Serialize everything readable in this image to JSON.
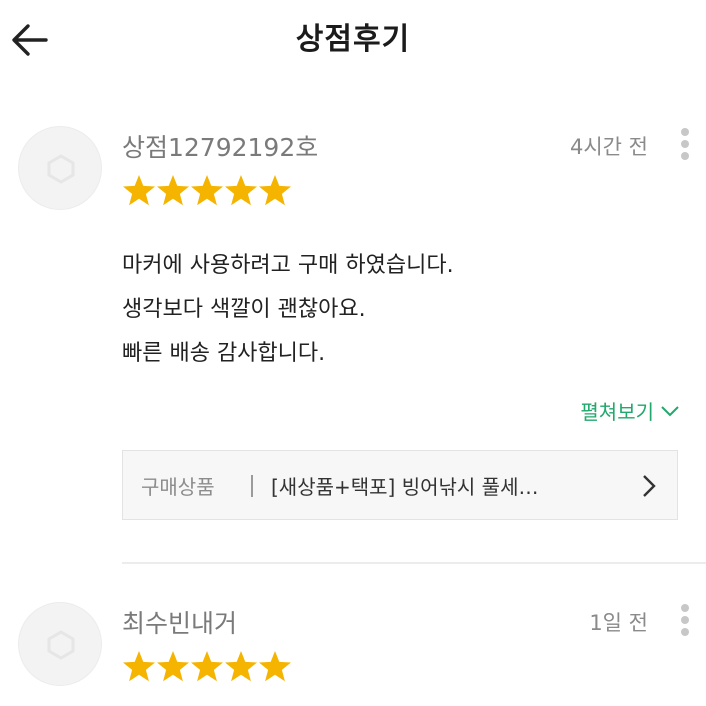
{
  "header": {
    "title": "상점후기",
    "back_icon": "arrow-left-icon"
  },
  "reviews": [
    {
      "author": "상점12792192호",
      "time": "4시간 전",
      "rating": 5,
      "lines": [
        "마커에 사용하려고 구매 하였습니다.",
        "생각보다 색깔이 괜찮아요.",
        "빠른 배송 감사합니다."
      ],
      "expand_label": "펼쳐보기",
      "product": {
        "label": "구매상품",
        "name": "[새상품+택포] 빙어낚시 풀세…"
      }
    },
    {
      "author": "최수빈내거",
      "time": "1일 전",
      "rating": 5
    }
  ],
  "colors": {
    "star": "#f5b400",
    "accent": "#22a86d"
  }
}
